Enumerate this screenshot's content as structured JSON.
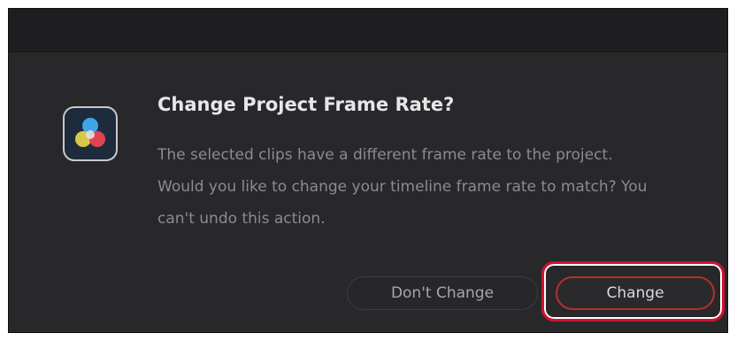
{
  "dialog": {
    "title": "Change Project Frame Rate?",
    "message": "The selected clips have a different frame rate to the project. Would you like to change your timeline frame rate to match? You can't undo this action.",
    "icon": "davinci-resolve-app-icon"
  },
  "buttons": {
    "dont_change_label": "Don't Change",
    "change_label": "Change"
  },
  "colors": {
    "highlight": "#d3102f",
    "dialog_background": "#28282a",
    "title_bar": "#1e1e20"
  }
}
